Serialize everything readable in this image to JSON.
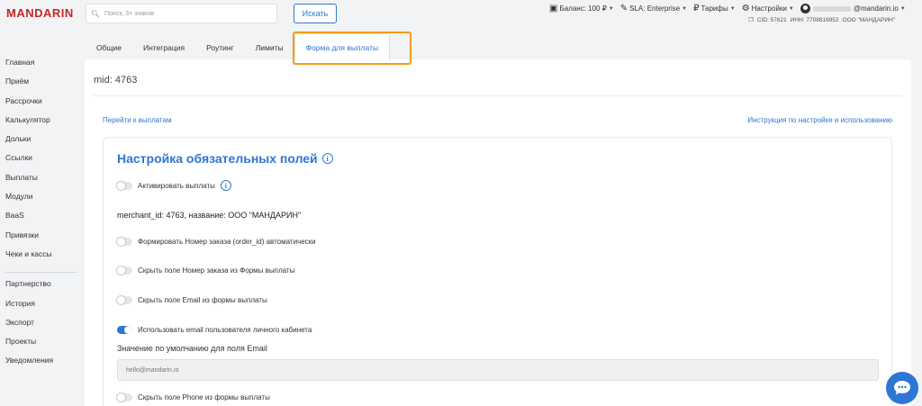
{
  "header": {
    "logo": "MANDARIN",
    "search_placeholder": "Поиск, 3+ знаков",
    "search_button": "Искать",
    "balance": "Баланс: 100 ₽",
    "sla": "SLA: Enterprise",
    "tariffs": "Тарифы",
    "settings": "Настройки",
    "email_suffix": "@mandarin.io",
    "cid": "CID: 57621",
    "inn": "ИНН: 7708816952",
    "company": "ООО \"МАНДАРИН\""
  },
  "sidebar": {
    "items_top": [
      "Главная",
      "Приём",
      "Рассрочки",
      "Калькулятор",
      "Дольки",
      "Ссылки",
      "Выплаты",
      "Модули",
      "BaaS",
      "Привязки",
      "Чеки и кассы"
    ],
    "items_bottom": [
      "Партнерство",
      "История",
      "Экспорт",
      "Проекты",
      "Уведомления"
    ]
  },
  "tabs": [
    "Общие",
    "Интеграция",
    "Роутинг",
    "Лимиты",
    "Форма для выплаты"
  ],
  "main": {
    "mid": "mid: 4763",
    "link_payouts": "Перейти к выплатам",
    "link_instructions": "Инструкция по настройке и использованию",
    "card_title": "Настройка обязательных полей",
    "activate_label": "Активировать выплаты",
    "merchant_info": "merchant_id: 4763, название: ООО \"МАНДАРИН\"",
    "toggles": [
      {
        "label": "Формировать Номер заказа (order_id) автоматически",
        "on": false
      },
      {
        "label": "Скрыть поле Номер заказа из Формы выплаты",
        "on": false
      },
      {
        "label": "Скрыть поле Email из формы выплаты",
        "on": false
      },
      {
        "label": "Использовать email пользователя личного кабинета",
        "on": true
      }
    ],
    "email_default_label": "Значение по умолчанию для поля Email",
    "email_default_value": "hello@mandarin.io",
    "phone_toggle_label": "Скрыть поле Phone из формы выплаты"
  },
  "colors": {
    "accent": "#2d76d6",
    "logo": "#c62828",
    "highlight": "#f39c12"
  }
}
